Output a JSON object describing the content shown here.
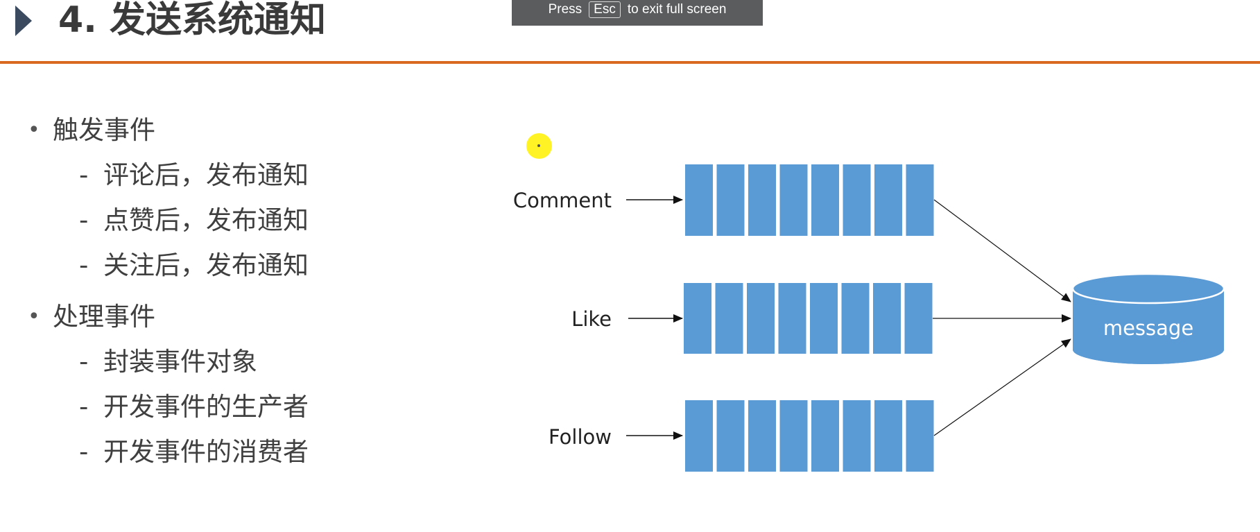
{
  "slide": {
    "title": "4. 发送系统通知"
  },
  "fullscreen_banner": {
    "press": "Press",
    "key": "Esc",
    "suffix": "to exit full screen"
  },
  "bullets": [
    {
      "text": "触发事件",
      "children": [
        "评论后，发布通知",
        "点赞后，发布通知",
        "关注后，发布通知"
      ]
    },
    {
      "text": "处理事件",
      "children": [
        "封装事件对象",
        "开发事件的生产者",
        "开发事件的消费者"
      ]
    }
  ],
  "diagram": {
    "queues": [
      {
        "label": "Comment"
      },
      {
        "label": "Like"
      },
      {
        "label": "Follow"
      }
    ],
    "slots_per_queue": 8,
    "database_label": "message",
    "colors": {
      "queue_fill": "#5b9bd5",
      "arrow": "#111111",
      "title_rule": "#d9691f",
      "title_marker": "#3b4a5e"
    }
  }
}
